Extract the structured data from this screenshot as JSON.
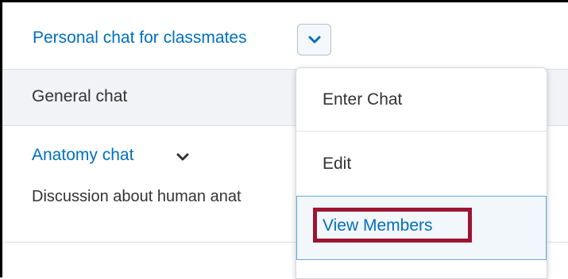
{
  "header": {
    "title": "Personal chat for classmates",
    "dropdown_icon": "chevron-down-icon"
  },
  "rows": [
    {
      "title": "General chat"
    },
    {
      "title": "Anatomy chat",
      "description": "Discussion about human anat"
    }
  ],
  "menu": {
    "items": [
      {
        "label": "Enter Chat"
      },
      {
        "label": "Edit"
      },
      {
        "label": "View Members",
        "highlighted": true
      }
    ]
  },
  "colors": {
    "link": "#006fbf",
    "highlight_border": "#9d1532",
    "selected_bg": "#f2f7fc",
    "selected_border": "#6aa9dc"
  }
}
